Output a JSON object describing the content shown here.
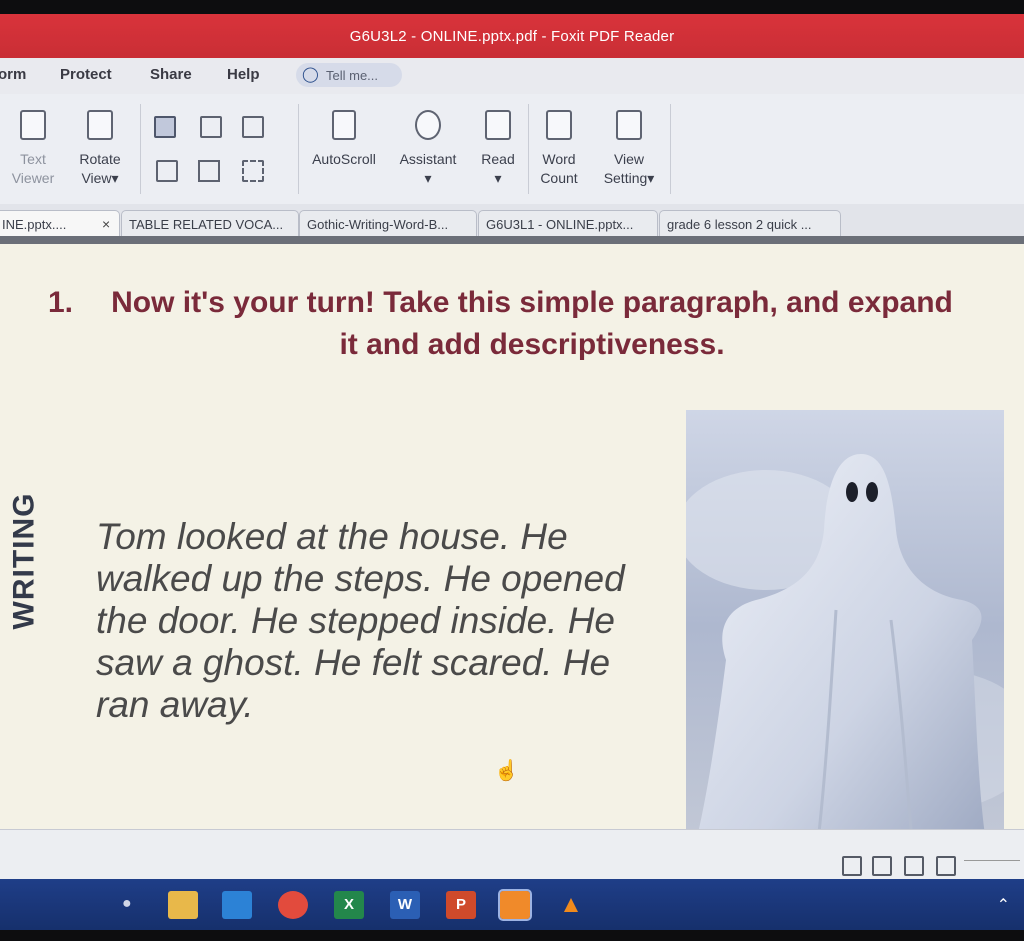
{
  "window": {
    "title": "G6U3L2 - ONLINE.pptx.pdf - Foxit PDF Reader"
  },
  "menu": {
    "items": [
      "orm",
      "Protect",
      "Share",
      "Help"
    ],
    "tell_me_placeholder": "Tell me..."
  },
  "ribbon": {
    "text_viewer": [
      "Text",
      "Viewer"
    ],
    "rotate_view": [
      "Rotate",
      "View"
    ],
    "autoscroll": "AutoScroll",
    "assistant": "Assistant",
    "read": "Read",
    "word_count": [
      "Word",
      "Count"
    ],
    "view_setting": [
      "View",
      "Setting"
    ]
  },
  "tabs": [
    {
      "label": "INE.pptx....",
      "active": true
    },
    {
      "label": "TABLE RELATED VOCA...",
      "active": false
    },
    {
      "label": "Gothic-Writing-Word-B...",
      "active": false
    },
    {
      "label": "G6U3L1 - ONLINE.pptx...",
      "active": false
    },
    {
      "label": "grade 6 lesson 2 quick ...",
      "active": false
    }
  ],
  "tab_close": "×",
  "slide": {
    "number": "1.",
    "heading": "Now it's your turn! Take this simple paragraph, and expand it and add descriptiveness.",
    "side_label": "WRITING",
    "paragraph": "Tom looked at the house. He walked up the steps. He opened the door. He stepped inside. He saw a ghost. He felt scared. He ran away."
  },
  "taskbar": {
    "apps": [
      "file-explorer",
      "camera",
      "chrome",
      "excel",
      "word",
      "powerpoint",
      "foxit",
      "vlc"
    ],
    "app_letters": {
      "excel": "X",
      "word": "W",
      "powerpoint": "P"
    }
  },
  "colors": {
    "titlebar": "#d9333b",
    "heading": "#7a2a3a",
    "slide_bg": "#f4f2e6",
    "taskbar": "#1f3e88"
  }
}
